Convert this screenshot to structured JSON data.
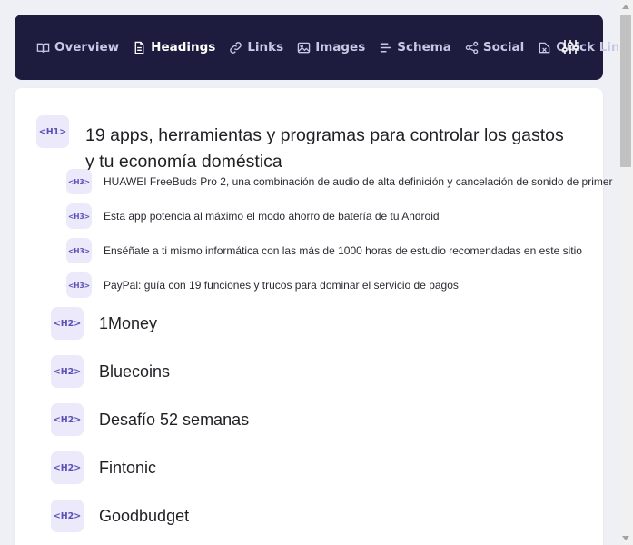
{
  "nav": {
    "items": [
      {
        "label": "Overview",
        "icon": "book-icon"
      },
      {
        "label": "Headings",
        "icon": "document-icon"
      },
      {
        "label": "Links",
        "icon": "link-icon"
      },
      {
        "label": "Images",
        "icon": "image-icon"
      },
      {
        "label": "Schema",
        "icon": "align-icon"
      },
      {
        "label": "Social",
        "icon": "share-icon"
      },
      {
        "label": "Quick Links",
        "icon": "quick-links-icon"
      }
    ],
    "active": "Headings",
    "settings_icon": "sliders-icon"
  },
  "headings": [
    {
      "level": "<H1>",
      "text": "19 apps, herramientas y programas para controlar los gastos y tu economía doméstica"
    },
    {
      "level": "<H3>",
      "text": "HUAWEI FreeBuds Pro 2, una combinación de audio de alta definición y cancelación de sonido de primer"
    },
    {
      "level": "<H3>",
      "text": "Esta app potencia al máximo el modo ahorro de batería de tu Android"
    },
    {
      "level": "<H3>",
      "text": "Enséñate a ti mismo informática con las más de 1000 horas de estudio recomendadas en este sitio"
    },
    {
      "level": "<H3>",
      "text": "PayPal: guía con 19 funciones y trucos para dominar el servicio de pagos"
    },
    {
      "level": "<H2>",
      "text": "1Money"
    },
    {
      "level": "<H2>",
      "text": "Bluecoins"
    },
    {
      "level": "<H2>",
      "text": "Desafío 52 semanas"
    },
    {
      "level": "<H2>",
      "text": "Fintonic"
    },
    {
      "level": "<H2>",
      "text": "Goodbudget"
    }
  ],
  "colors": {
    "navbar": "#1d1c3f",
    "badge_bg": "#ece9fb",
    "badge_text": "#5b52b8",
    "page_bg": "#eef0f6"
  }
}
